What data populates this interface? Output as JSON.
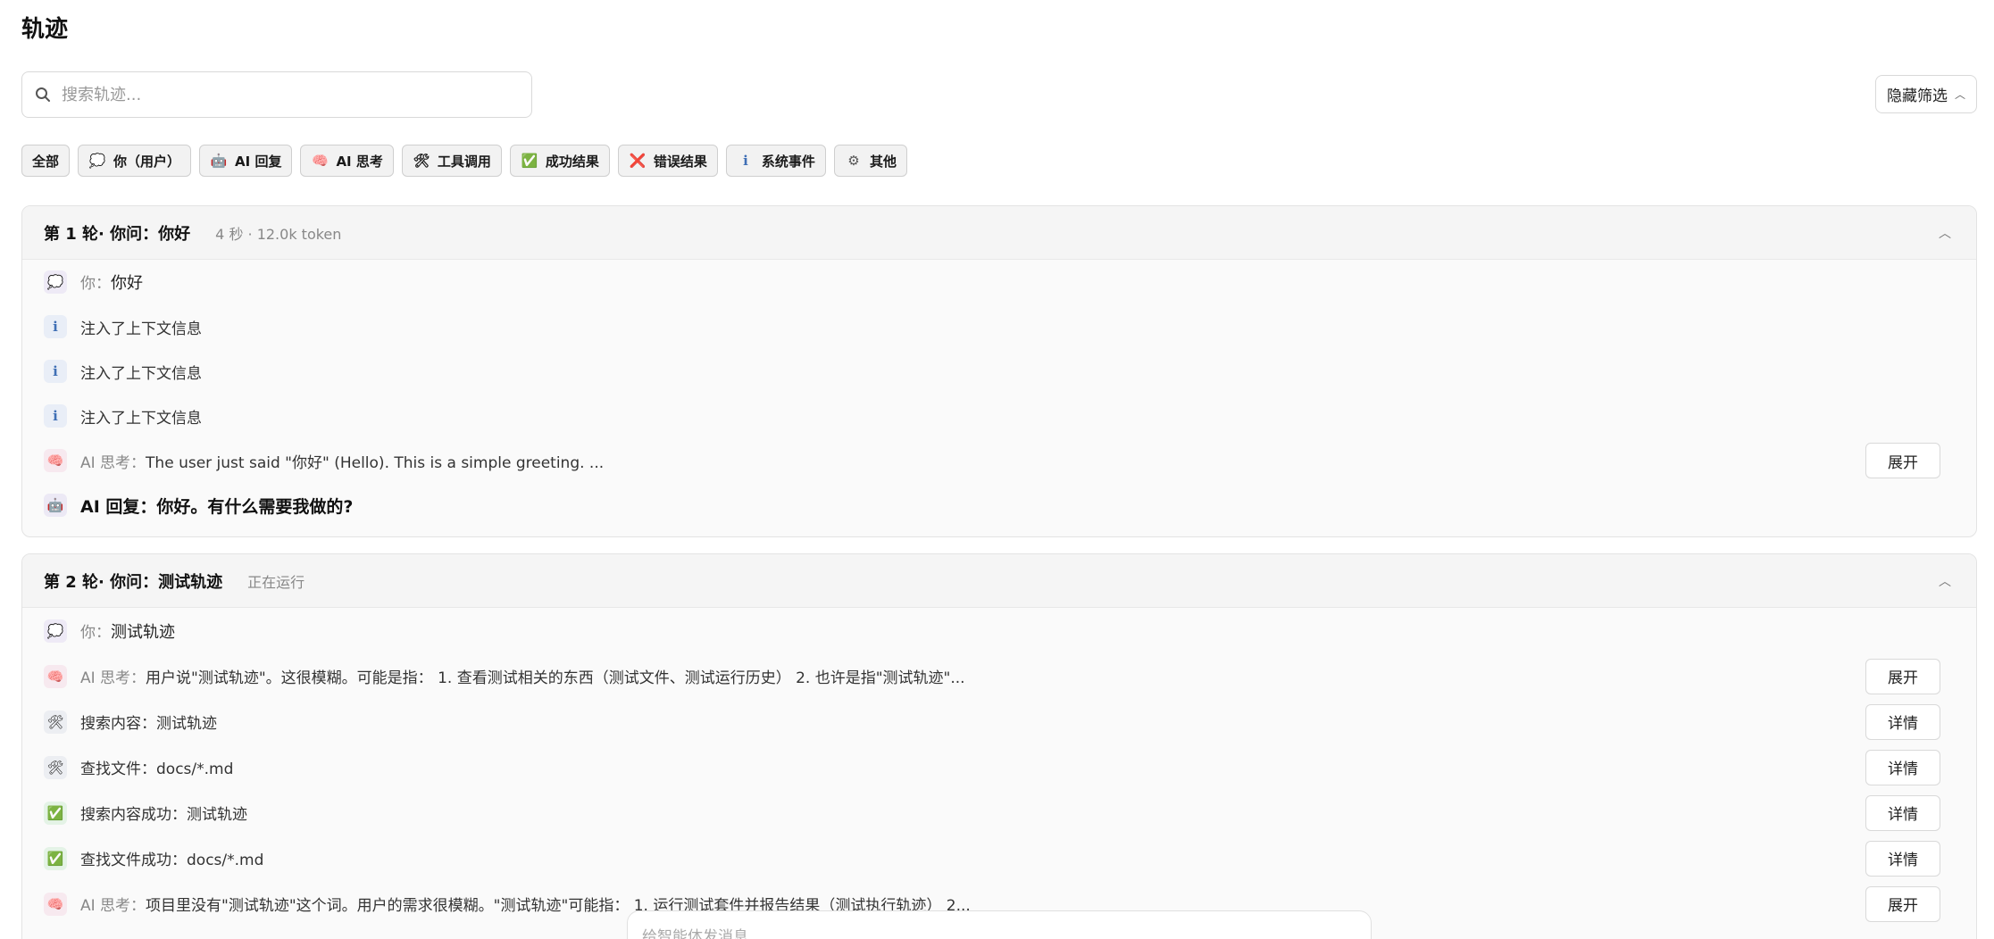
{
  "page": {
    "title": "轨迹"
  },
  "search": {
    "placeholder": "搜索轨迹..."
  },
  "hide_filter": {
    "label": "隐藏筛选"
  },
  "filters": [
    {
      "label": "全部"
    },
    {
      "label": "你（用户）",
      "icon": "💭"
    },
    {
      "label": "AI 回复",
      "icon": "🤖"
    },
    {
      "label": "AI 思考",
      "icon": "🧠"
    },
    {
      "label": "工具调用",
      "icon": "🛠"
    },
    {
      "label": "成功结果",
      "icon": "✅"
    },
    {
      "label": "错误结果",
      "icon": "❌"
    },
    {
      "label": "系统事件",
      "icon": "i"
    },
    {
      "label": "其他",
      "icon": "⚙"
    }
  ],
  "rounds": [
    {
      "title": "第 1 轮· 你问：你好",
      "meta": "4 秒 · 12.0k token",
      "rows": [
        {
          "label": "你：",
          "text": "你好"
        },
        {
          "text": "注入了上下文信息"
        },
        {
          "text": "注入了上下文信息"
        },
        {
          "text": "注入了上下文信息"
        },
        {
          "label": "AI 思考：",
          "text": "The user just said \"你好\" (Hello). This is a simple greeting. ...",
          "button": "展开"
        },
        {
          "text": "AI 回复：你好。有什么需要我做的?"
        }
      ]
    },
    {
      "title": "第 2 轮· 你问：测试轨迹",
      "meta": "正在运行",
      "rows": [
        {
          "label": "你：",
          "text": "测试轨迹"
        },
        {
          "label": "AI 思考：",
          "text": "用户说\"测试轨迹\"。这很模糊。可能是指： 1. 查看测试相关的东西（测试文件、测试运行历史） 2. 也许是指\"测试轨迹\"...",
          "button": "展开"
        },
        {
          "label": "搜索内容：",
          "text": "测试轨迹",
          "button": "详情"
        },
        {
          "label": "查找文件：",
          "text": "docs/*.md",
          "button": "详情"
        },
        {
          "label": "搜索内容成功：",
          "text": "测试轨迹",
          "button": "详情"
        },
        {
          "label": "查找文件成功：",
          "text": "docs/*.md",
          "button": "详情"
        },
        {
          "label": "AI 思考：",
          "text": "项目里没有\"测试轨迹\"这个词。用户的需求很模糊。\"测试轨迹\"可能指： 1. 运行测试套件并报告结果（测试执行轨迹） 2...",
          "button": "展开"
        }
      ]
    }
  ],
  "composer": {
    "placeholder": "给智能体发消息"
  }
}
